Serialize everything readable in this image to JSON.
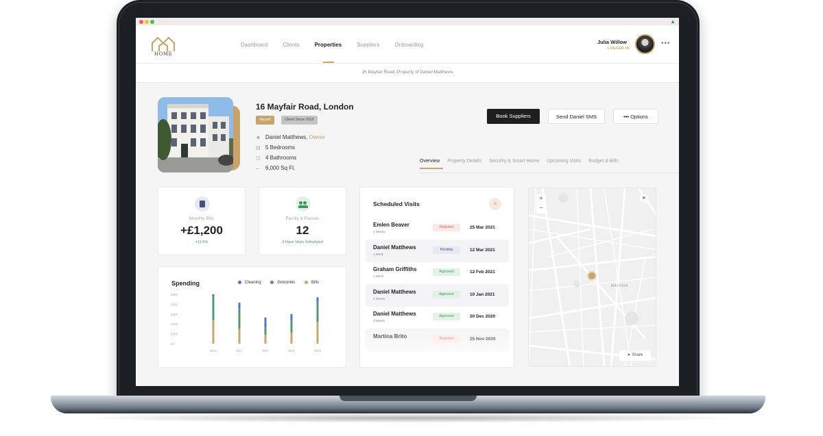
{
  "window": {
    "dots": [
      "#f25f58",
      "#fbbe2e",
      "#37c840"
    ]
  },
  "app": {
    "logo_text": "HOME",
    "accent": "#c9a46a"
  },
  "nav": {
    "items": [
      "Dashboard",
      "Clients",
      "Properties",
      "Suppliers",
      "Onboarding"
    ],
    "active": "Properties"
  },
  "user": {
    "name": "Julia Willow",
    "status": "LOGGED IN"
  },
  "breadcrumb": "16 Mayfair Road, Property of Daniel Matthews",
  "property": {
    "title": "16 Mayfair Road, London",
    "badges": [
      "Vacant",
      "Client Since 2015"
    ],
    "owner_name": "Daniel Matthews, ",
    "owner_role": "Owner",
    "bedrooms": "5 Bedrooms",
    "bathrooms": "4 Bathrooms",
    "area": "6,000 Sq Ft."
  },
  "actions": {
    "book": "Book Suppliers",
    "sms": "Send Daniel SMS",
    "options": "Options"
  },
  "tabs": [
    "Overview",
    "Property Details",
    "Security & Smart Home",
    "Upcoming Visits",
    "Budget & Bills"
  ],
  "stats": {
    "bills": {
      "label": "Monthly Bills",
      "value": "+£1,200",
      "sub": "+12.5%"
    },
    "family": {
      "label": "Family & Friends",
      "value": "12",
      "sub": "3 Have Visits Scheduled"
    }
  },
  "spending": {
    "title": "Spending",
    "legend": [
      {
        "name": "Cleaning",
        "color": "#4a72d9"
      },
      {
        "name": "Groceries",
        "color": "#4f9a72"
      },
      {
        "name": "Bills",
        "color": "#c9a46a"
      }
    ]
  },
  "chart_data": {
    "type": "bar",
    "stacked": true,
    "title": "Spending",
    "categories": [
      "WK5",
      "WK7",
      "WK7",
      "WK1",
      "WK9"
    ],
    "yticks": [
      "£500",
      "£400",
      "£300",
      "£200",
      "£100",
      "£0"
    ],
    "ylim": [
      0,
      500
    ],
    "series": [
      {
        "name": "Bills",
        "color": "#c9a46a",
        "values": [
          235,
          150,
          90,
          110,
          220
        ]
      },
      {
        "name": "Groceries",
        "color": "#4f9a72",
        "values": [
          240,
          210,
          80,
          115,
          205
        ]
      },
      {
        "name": "Cleaning",
        "color": "#4a72d9",
        "values": [
          25,
          55,
          95,
          75,
          45
        ]
      }
    ]
  },
  "visits": {
    "title": "Scheduled Visits",
    "items": [
      {
        "name": "Emlen Beaver",
        "when": "2 Weeks",
        "status": "Rejected",
        "date": "25 Mar 2021"
      },
      {
        "name": "Daniel Matthews",
        "when": "1 Week",
        "status": "Pending",
        "date": "12 Mar 2021"
      },
      {
        "name": "Graham Griffiths",
        "when": "1 Week",
        "status": "Approved",
        "date": "12 Feb 2021"
      },
      {
        "name": "Daniel Matthews",
        "when": "4 Weeks",
        "status": "Approved",
        "date": "10 Jan 2021"
      },
      {
        "name": "Daniel Matthews",
        "when": "3 Weeks",
        "status": "Approved",
        "date": "20 Dec 2020"
      },
      {
        "name": "Martina Brito",
        "when": "",
        "status": "Rejected",
        "date": "25 Nov 2020"
      }
    ]
  },
  "map": {
    "district": "MAYFAIR",
    "share": "Share",
    "zoom_in": "+",
    "zoom_out": "−"
  }
}
